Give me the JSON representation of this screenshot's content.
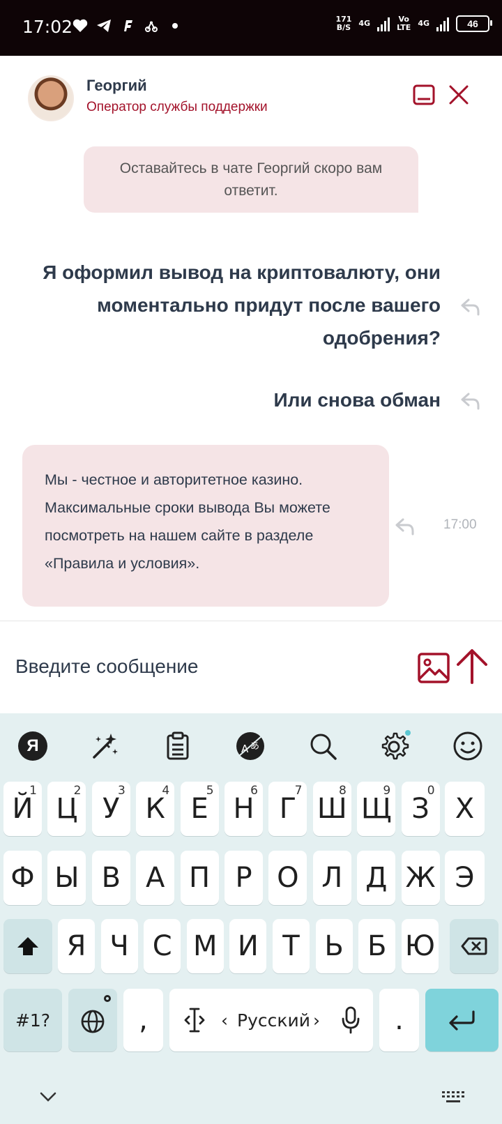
{
  "status_bar": {
    "time": "17:02",
    "speed_value": "171",
    "speed_unit": "B/S",
    "net1": "4G",
    "net2_top": "Vo",
    "net2_bottom": "LTE",
    "net3": "4G",
    "battery": "46",
    "icons": [
      "heart-icon",
      "telegram-icon",
      "f-app-icon",
      "bicycle-icon",
      "dot-icon"
    ]
  },
  "chat": {
    "agent_name": "Георгий",
    "agent_role": "Оператор службы поддержки",
    "system_message": "Оставайтесь в чате Георгий скоро вам ответит.",
    "user_messages": [
      {
        "lines": [
          "Я оформил вывод на криптовалюту, они",
          "моментально придут после вашего",
          "одобрения?"
        ]
      },
      {
        "lines": [
          "Или снова обман"
        ]
      }
    ],
    "operator_message": "Мы - честное и авторитетное казино. Максимальные сроки вывода Вы можете посмотреть на нашем сайте в разделе «Правила и условия».",
    "operator_time": "17:00",
    "accent_color": "#a3122a",
    "bubble_color": "#f5e4e6"
  },
  "composer": {
    "placeholder": "Введите сообщение"
  },
  "keyboard": {
    "toolbar": [
      "yandex-icon",
      "magic-wand-icon",
      "clipboard-icon",
      "translate-icon",
      "search-icon",
      "settings-icon",
      "emoji-icon"
    ],
    "yandex_letter": "Я",
    "row1": [
      "Й",
      "Ц",
      "У",
      "К",
      "Е",
      "Н",
      "Г",
      "Ш",
      "Щ",
      "З",
      "Х"
    ],
    "row1_hints": [
      "1",
      "2",
      "3",
      "4",
      "5",
      "6",
      "7",
      "8",
      "9",
      "0",
      ""
    ],
    "row2": [
      "Ф",
      "Ы",
      "В",
      "А",
      "П",
      "Р",
      "О",
      "Л",
      "Д",
      "Ж",
      "Э"
    ],
    "row3": [
      "Я",
      "Ч",
      "С",
      "М",
      "И",
      "Т",
      "Ь",
      "Б",
      "Ю"
    ],
    "symbols_key": "#1?",
    "comma": ",",
    "period": ".",
    "space_label": "Русский",
    "space_left_arrow": "‹",
    "space_right_arrow": "›"
  }
}
